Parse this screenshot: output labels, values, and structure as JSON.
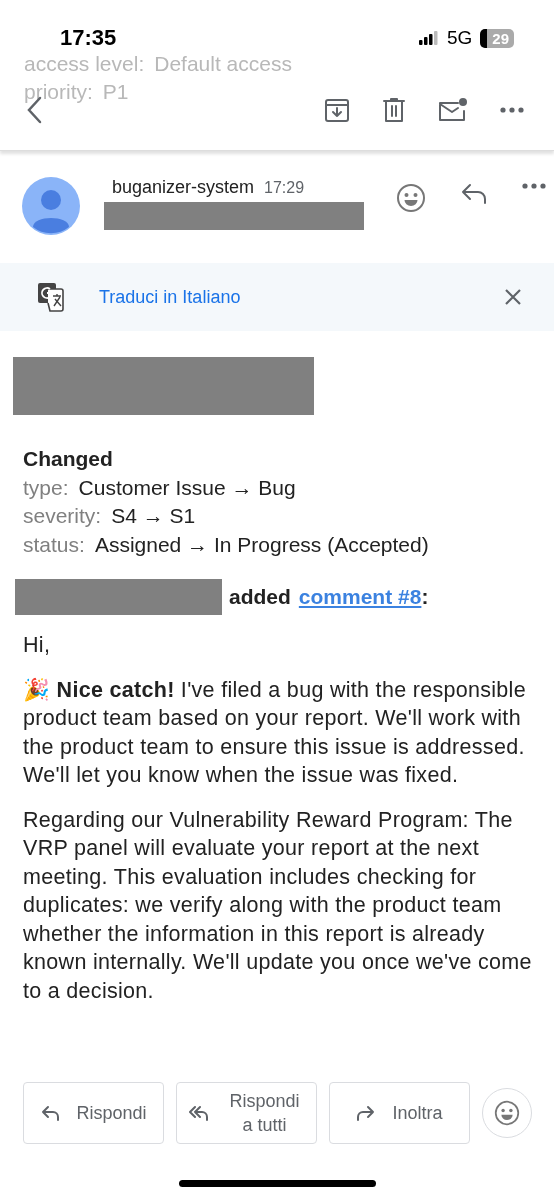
{
  "background_lines": [
    {
      "label": "access level:",
      "value": "Default access"
    },
    {
      "label": "priority:",
      "value": "P1"
    }
  ],
  "status_bar": {
    "time": "17:35",
    "network": "5G",
    "battery": "29"
  },
  "sender": {
    "name": "buganizer-system",
    "time": "17:29"
  },
  "translate_banner": {
    "link": "Traduci in Italiano"
  },
  "changes": {
    "title": "Changed",
    "rows": [
      {
        "field": "type:",
        "value": "Customer Issue → Bug"
      },
      {
        "field": "severity:",
        "value": "S4 → S1"
      },
      {
        "field": "status:",
        "value": "Assigned → In Progress (Accepted)"
      }
    ]
  },
  "comment_header": {
    "verb": "added",
    "link": "comment #8",
    "suffix": ":"
  },
  "paragraphs": [
    "Hi,",
    "🎉 **Nice catch!** I've filed a bug with the responsible product team based on your report. We'll work with the product team to ensure this issue is addressed. We'll let you know when the issue was fixed.",
    "Regarding our Vulnerability Reward Program: The VRP panel will evaluate your report at the next meeting. This evaluation includes checking for duplicates: we verify along with the product team whether the information in this report is already known internally. We'll update you once we've come to a decision."
  ],
  "actions": [
    {
      "kind": "reply",
      "label": "Rispondi"
    },
    {
      "kind": "reply_all",
      "label": "Rispondi a tutti"
    },
    {
      "kind": "forward",
      "label": "Inoltra"
    }
  ]
}
